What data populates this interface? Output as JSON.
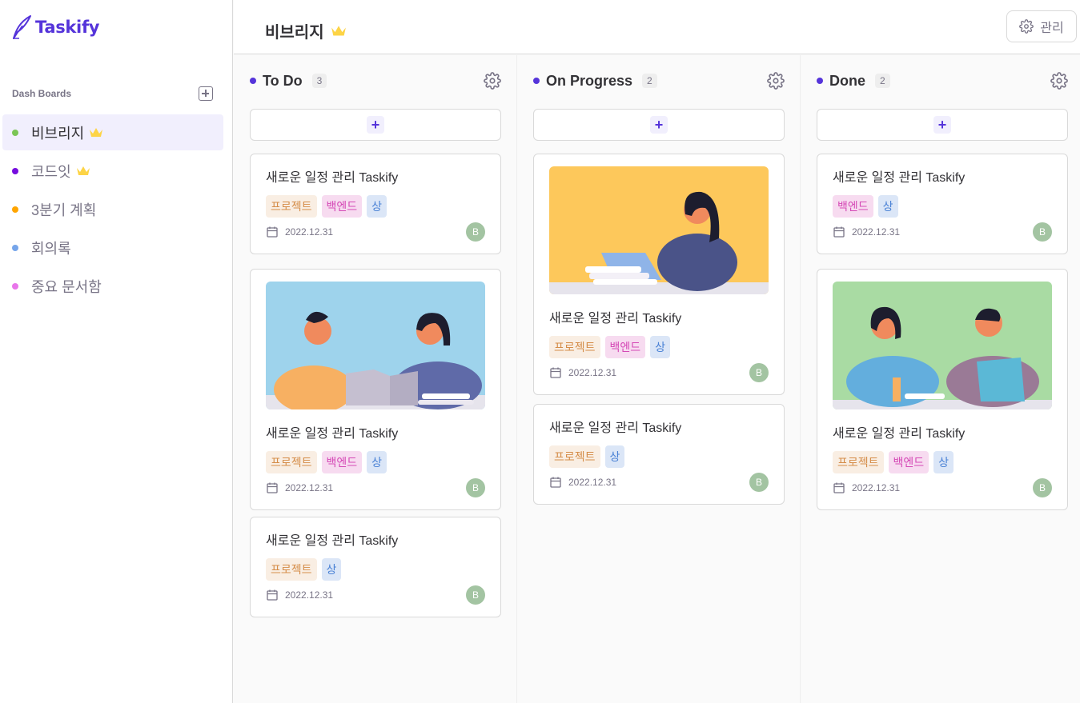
{
  "app": {
    "name": "Taskify",
    "brand_color": "#5534da"
  },
  "sidebar": {
    "section_title": "Dash Boards",
    "boards": [
      {
        "label": "비브리지",
        "color": "#7ac555",
        "owner_crown": true,
        "active": true
      },
      {
        "label": "코드잇",
        "color": "#760dde",
        "owner_crown": true,
        "active": false
      },
      {
        "label": "3분기 계획",
        "color": "#ffa500",
        "owner_crown": false,
        "active": false
      },
      {
        "label": "회의록",
        "color": "#76a5ea",
        "owner_crown": false,
        "active": false
      },
      {
        "label": "중요 문서함",
        "color": "#e876ea",
        "owner_crown": false,
        "active": false
      }
    ]
  },
  "header": {
    "title": "비브리지",
    "manage_label": "관리"
  },
  "columns": [
    {
      "title": "To Do",
      "count": "3",
      "cards": [
        {
          "title": "새로운 일정 관리 Taskify",
          "tags": [
            "프로젝트",
            "백엔드",
            "상"
          ],
          "date": "2022.12.31",
          "avatar": "B",
          "image": null
        },
        {
          "title": "새로운 일정 관리 Taskify",
          "tags": [
            "프로젝트",
            "백엔드",
            "상"
          ],
          "date": "2022.12.31",
          "avatar": "B",
          "image": "two-people-reading"
        },
        {
          "title": "새로운 일정 관리 Taskify",
          "tags": [
            "프로젝트",
            "상"
          ],
          "date": "2022.12.31",
          "avatar": "B",
          "image": null
        }
      ]
    },
    {
      "title": "On Progress",
      "count": "2",
      "cards": [
        {
          "title": "새로운 일정 관리 Taskify",
          "tags": [
            "프로젝트",
            "백엔드",
            "상"
          ],
          "date": "2022.12.31",
          "avatar": "B",
          "image": "woman-laptop"
        },
        {
          "title": "새로운 일정 관리 Taskify",
          "tags": [
            "프로젝트",
            "상"
          ],
          "date": "2022.12.31",
          "avatar": "B",
          "image": null
        }
      ]
    },
    {
      "title": "Done",
      "count": "2",
      "cards": [
        {
          "title": "새로운 일정 관리 Taskify",
          "tags": [
            "백엔드",
            "상"
          ],
          "date": "2022.12.31",
          "avatar": "B",
          "image": null
        },
        {
          "title": "새로운 일정 관리 Taskify",
          "tags": [
            "프로젝트",
            "백엔드",
            "상"
          ],
          "date": "2022.12.31",
          "avatar": "B",
          "image": "two-people-studying"
        }
      ]
    }
  ]
}
